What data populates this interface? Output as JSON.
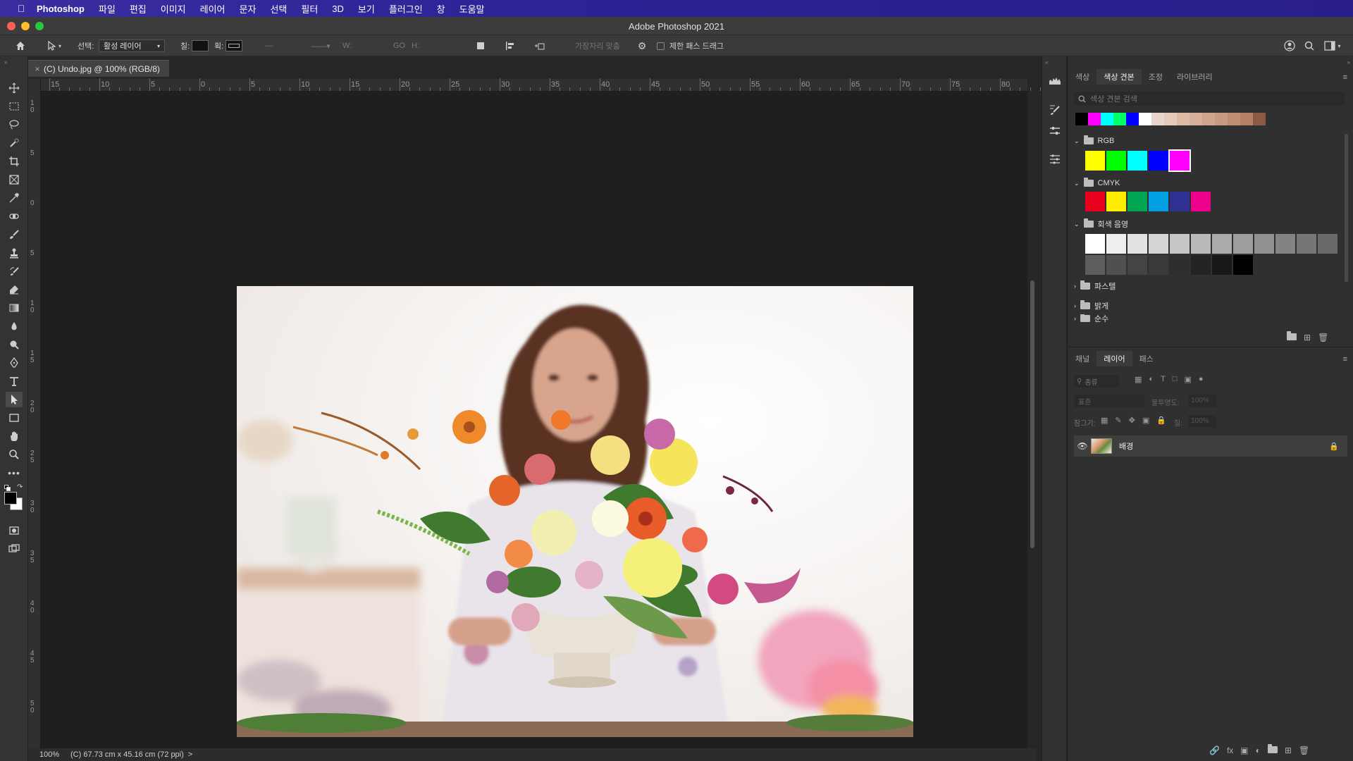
{
  "menubar": {
    "app": "Photoshop",
    "items": [
      "파일",
      "편집",
      "이미지",
      "레이어",
      "문자",
      "선택",
      "필터",
      "3D",
      "보기",
      "플러그인",
      "창",
      "도움말"
    ]
  },
  "window": {
    "title": "Adobe Photoshop 2021"
  },
  "options": {
    "select_label": "선택:",
    "select_value": "활성 레이어",
    "fill_label": "칠:",
    "stroke_label": "획:",
    "w_label": "W:",
    "go_label": "GO",
    "h_label": "H:",
    "align_edges": "가장자리 맞춤",
    "constrain_path": "제한 패스 드래그"
  },
  "document": {
    "tab_title": "(C) Undo.jpg @ 100% (RGB/8)",
    "zoom": "100%",
    "info": "(C) 67.73 cm x 45.16 cm (72 ppi)",
    "info_arrow": ">"
  },
  "ruler": {
    "h_labels": [
      "15",
      "10",
      "5",
      "0",
      "5",
      "10",
      "15",
      "20",
      "25",
      "30",
      "35",
      "40",
      "45",
      "50",
      "55",
      "60",
      "65",
      "70",
      "75",
      "80"
    ],
    "v_labels": [
      "1 0",
      "5",
      "0",
      "5",
      "1 0",
      "1 5",
      "2 0",
      "2 5",
      "3 0",
      "3 5",
      "4 0",
      "4 5",
      "5 0"
    ]
  },
  "swatches_panel": {
    "tabs": [
      "색상",
      "색상 견본",
      "조정",
      "라이브러리"
    ],
    "active_tab": "색상 견본",
    "search_placeholder": "색상 견본 검색",
    "recent": [
      "#000000",
      "#ff00ff",
      "#00ffff",
      "#00ff66",
      "#0000ff",
      "#ffffff",
      "#e8d6cc",
      "#e6c9b8",
      "#dbb9a4",
      "#d6b09a",
      "#cfa48c",
      "#c89b80",
      "#bf8e72",
      "#b58066",
      "#8a5a44"
    ],
    "groups": [
      {
        "name": "RGB",
        "expanded": true,
        "colors": [
          "#ffff00",
          "#00ff00",
          "#00ffff",
          "#0000ff",
          "#ff00ff"
        ]
      },
      {
        "name": "CMYK",
        "expanded": true,
        "colors": [
          "#e8001c",
          "#ffed00",
          "#00a651",
          "#00a0e3",
          "#2e3192",
          "#ec008c"
        ]
      },
      {
        "name": "회색 음영",
        "expanded": true,
        "row1": [
          "#ffffff",
          "#eeeeee",
          "#e2e2e2",
          "#d4d4d4",
          "#c6c6c6",
          "#b9b9b9",
          "#ababab",
          "#9e9e9e",
          "#909090",
          "#838383",
          "#767676",
          "#696969"
        ],
        "row2": [
          "#5d5d5d",
          "#505050",
          "#444444",
          "#393939",
          "#2e2e2e",
          "#232323",
          "#171717",
          "#000000"
        ]
      },
      {
        "name": "파스텔",
        "expanded": false
      },
      {
        "name": "밝게",
        "expanded": false
      },
      {
        "name": "순수",
        "expanded": false
      }
    ]
  },
  "layers_panel": {
    "tabs": [
      "채널",
      "레이어",
      "패스"
    ],
    "active_tab": "레이어",
    "filter_placeholder": "종류",
    "blend_mode": "표준",
    "opacity_label": "불투명도:",
    "opacity_value": "100%",
    "lock_label": "잠그기:",
    "fill_label": "칠:",
    "fill_value": "100%",
    "layers": [
      {
        "name": "배경",
        "visible": true,
        "locked": true
      }
    ]
  }
}
